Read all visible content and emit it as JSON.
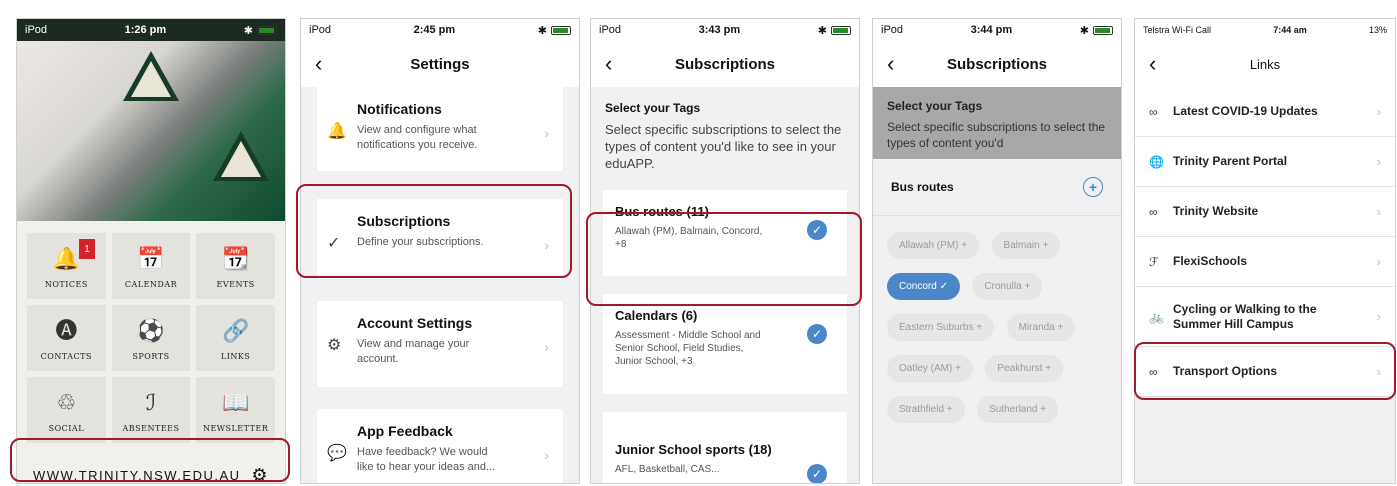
{
  "screen1": {
    "status": {
      "carrier": "iPod",
      "time": "1:26 pm"
    },
    "tiles": [
      {
        "icon": "bell-icon",
        "glyph": "🔔",
        "label": "NOTICES",
        "badge": "1"
      },
      {
        "icon": "calendar-icon",
        "glyph": "📅",
        "label": "CALENDAR"
      },
      {
        "icon": "events-icon",
        "glyph": "📆",
        "label": "EVENTS"
      },
      {
        "icon": "contacts-icon",
        "glyph": "🅐",
        "label": "CONTACTS"
      },
      {
        "icon": "sports-ball-icon",
        "glyph": "⚽",
        "label": "SPORTS"
      },
      {
        "icon": "link-icon",
        "glyph": "🔗",
        "label": "LINKS"
      },
      {
        "icon": "social-icon",
        "glyph": "♲",
        "label": "SOCIAL"
      },
      {
        "icon": "absentees-icon",
        "glyph": "ℐ",
        "label": "ABSENTEES"
      },
      {
        "icon": "newsletter-icon",
        "glyph": "📖",
        "label": "NEWSLETTER"
      }
    ],
    "footer_url": "WWW.TRINITY.NSW.EDU.AU"
  },
  "screen2": {
    "status": {
      "carrier": "iPod",
      "time": "2:45 pm"
    },
    "title": "Settings",
    "cards": [
      {
        "icon": "bell-icon",
        "glyph": "🔔",
        "title": "Notifications",
        "desc": "View and configure what notifications you receive."
      },
      {
        "icon": "check-circle-icon",
        "glyph": "✓",
        "title": "Subscriptions",
        "desc": "Define your subscriptions."
      },
      {
        "icon": "gear-icon",
        "glyph": "⚙",
        "title": "Account Settings",
        "desc": "View and manage your account."
      },
      {
        "icon": "chat-bubble-icon",
        "glyph": "💬",
        "title": "App Feedback",
        "desc": "Have feedback? We would like to hear your ideas and..."
      }
    ]
  },
  "screen3": {
    "status": {
      "carrier": "iPod",
      "time": "3:43 pm"
    },
    "title": "Subscriptions",
    "lead_title": "Select your Tags",
    "lead_desc": "Select specific subscriptions to select the types of content you'd like to see in your eduAPP.",
    "subs": [
      {
        "title": "Bus routes (11)",
        "desc": "Allawah (PM), Balmain, Concord, +8"
      },
      {
        "title": "Calendars (6)",
        "desc": "Assessment - Middle School and Senior School, Field Studies, Junior School, +3"
      },
      {
        "title": "Junior School sports (18)",
        "desc": "AFL, Basketball, CAS..."
      }
    ]
  },
  "screen4": {
    "status": {
      "carrier": "iPod",
      "time": "3:44 pm"
    },
    "title": "Subscriptions",
    "lead_title": "Select your Tags",
    "lead_desc": "Select specific subscriptions to select the types of content you'd",
    "group": "Bus routes",
    "chips": [
      {
        "label": "Allawah (PM) +",
        "selected": false
      },
      {
        "label": "Balmain +",
        "selected": false
      },
      {
        "label": "Concord ✓",
        "selected": true
      },
      {
        "label": "Cronulla +",
        "selected": false
      },
      {
        "label": "Eastern Suburbs +",
        "selected": false
      },
      {
        "label": "Miranda +",
        "selected": false
      },
      {
        "label": "Oatley (AM) +",
        "selected": false
      },
      {
        "label": "Peakhurst +",
        "selected": false
      },
      {
        "label": "Strathfield +",
        "selected": false
      },
      {
        "label": "Sutherland +",
        "selected": false
      }
    ]
  },
  "screen5": {
    "status": {
      "carrier": "Telstra Wi-Fi Call",
      "time": "7:44 am",
      "battery": "13%"
    },
    "title": "Links",
    "links": [
      {
        "icon": "link-icon",
        "glyph": "∞",
        "label": "Latest COVID-19 Updates"
      },
      {
        "icon": "globe-icon",
        "glyph": "🌐",
        "label": "Trinity Parent Portal"
      },
      {
        "icon": "link-icon",
        "glyph": "∞",
        "label": "Trinity Website"
      },
      {
        "icon": "flexischools-icon",
        "glyph": "ℱ",
        "label": "FlexiSchools"
      },
      {
        "icon": "bicycle-icon",
        "glyph": "🚲",
        "label": "Cycling or Walking to the Summer Hill Campus"
      },
      {
        "icon": "link-icon",
        "glyph": "∞",
        "label": "Transport Options"
      }
    ]
  }
}
